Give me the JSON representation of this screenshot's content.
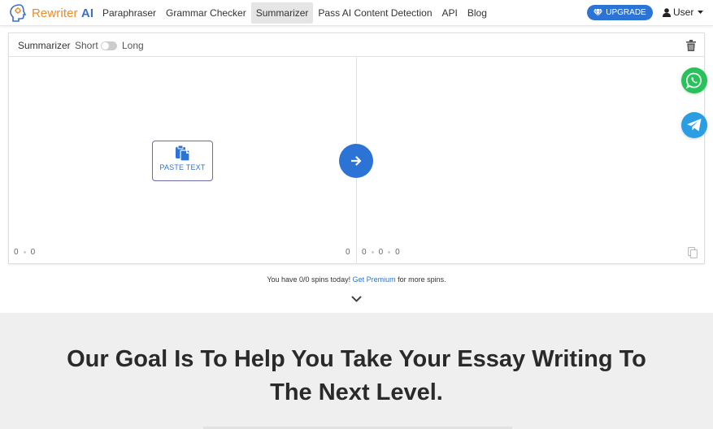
{
  "navbar": {
    "logo_prefix": "Rewriter",
    "logo_suffix": "AI",
    "links": [
      {
        "label": "Paraphraser"
      },
      {
        "label": "Grammar Checker"
      },
      {
        "label": "Summarizer",
        "active": true
      },
      {
        "label": "Pass AI Content Detection"
      },
      {
        "label": "API"
      },
      {
        "label": "Blog"
      }
    ],
    "upgrade_label": "UPGRADE",
    "user_label": "User"
  },
  "tool": {
    "mode_title": "Summarizer",
    "short_label": "Short",
    "long_label": "Long",
    "paste_label": "PASTE TEXT",
    "input_counter": {
      "a": "0",
      "b": "0"
    },
    "input_right_counter": "0",
    "output_counter": {
      "a": "0",
      "b": "0",
      "c": "0"
    }
  },
  "spins": {
    "prefix": "You have 0/0 spins today!",
    "link": "Get Premium",
    "suffix": "for more spins."
  },
  "hero": {
    "line1": "Our Goal Is To Help You Take Your Essay Writing To",
    "line2": "The Next Level."
  },
  "colors": {
    "accent": "#2b74d6",
    "whatsapp": "#27c35a",
    "telegram": "#2a9de3",
    "logo_orange": "#f08a24"
  }
}
